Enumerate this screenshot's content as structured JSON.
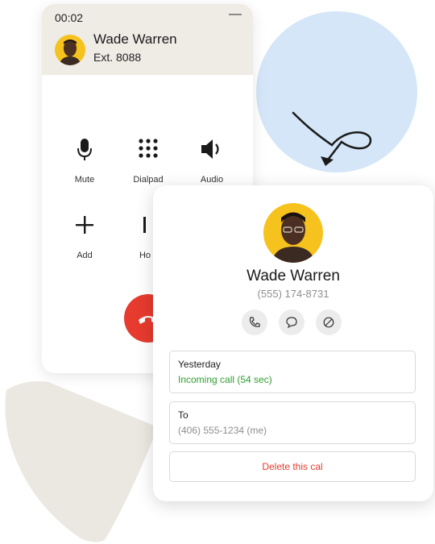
{
  "call": {
    "timer": "00:02",
    "minimize": "—",
    "name": "Wade Warren",
    "ext": "Ext. 8088",
    "controls": [
      {
        "label": "Mute",
        "icon": "microphone-icon"
      },
      {
        "label": "Dialpad",
        "icon": "dialpad-icon"
      },
      {
        "label": "Audio",
        "icon": "speaker-icon"
      },
      {
        "label": "Add",
        "icon": "plus-icon"
      },
      {
        "label": "Ho",
        "icon": "hold-icon"
      }
    ],
    "end_color": "#e63b2e"
  },
  "contact": {
    "name": "Wade Warren",
    "phone": "(555) 174-8731",
    "actions": [
      "phone-icon",
      "message-icon",
      "block-icon"
    ],
    "history": {
      "title": "Yesterday",
      "value": "Incoming call (54 sec)",
      "value_color": "#2f9e2f"
    },
    "to": {
      "title": "To",
      "value": "(406) 555-1234 (me)"
    },
    "delete_label": "Delete this cal",
    "delete_color": "#e63b2e"
  },
  "colors": {
    "accent_blue": "#d4e6f7",
    "header_beige": "#efece6",
    "avatar_yellow": "#f6c21d"
  }
}
